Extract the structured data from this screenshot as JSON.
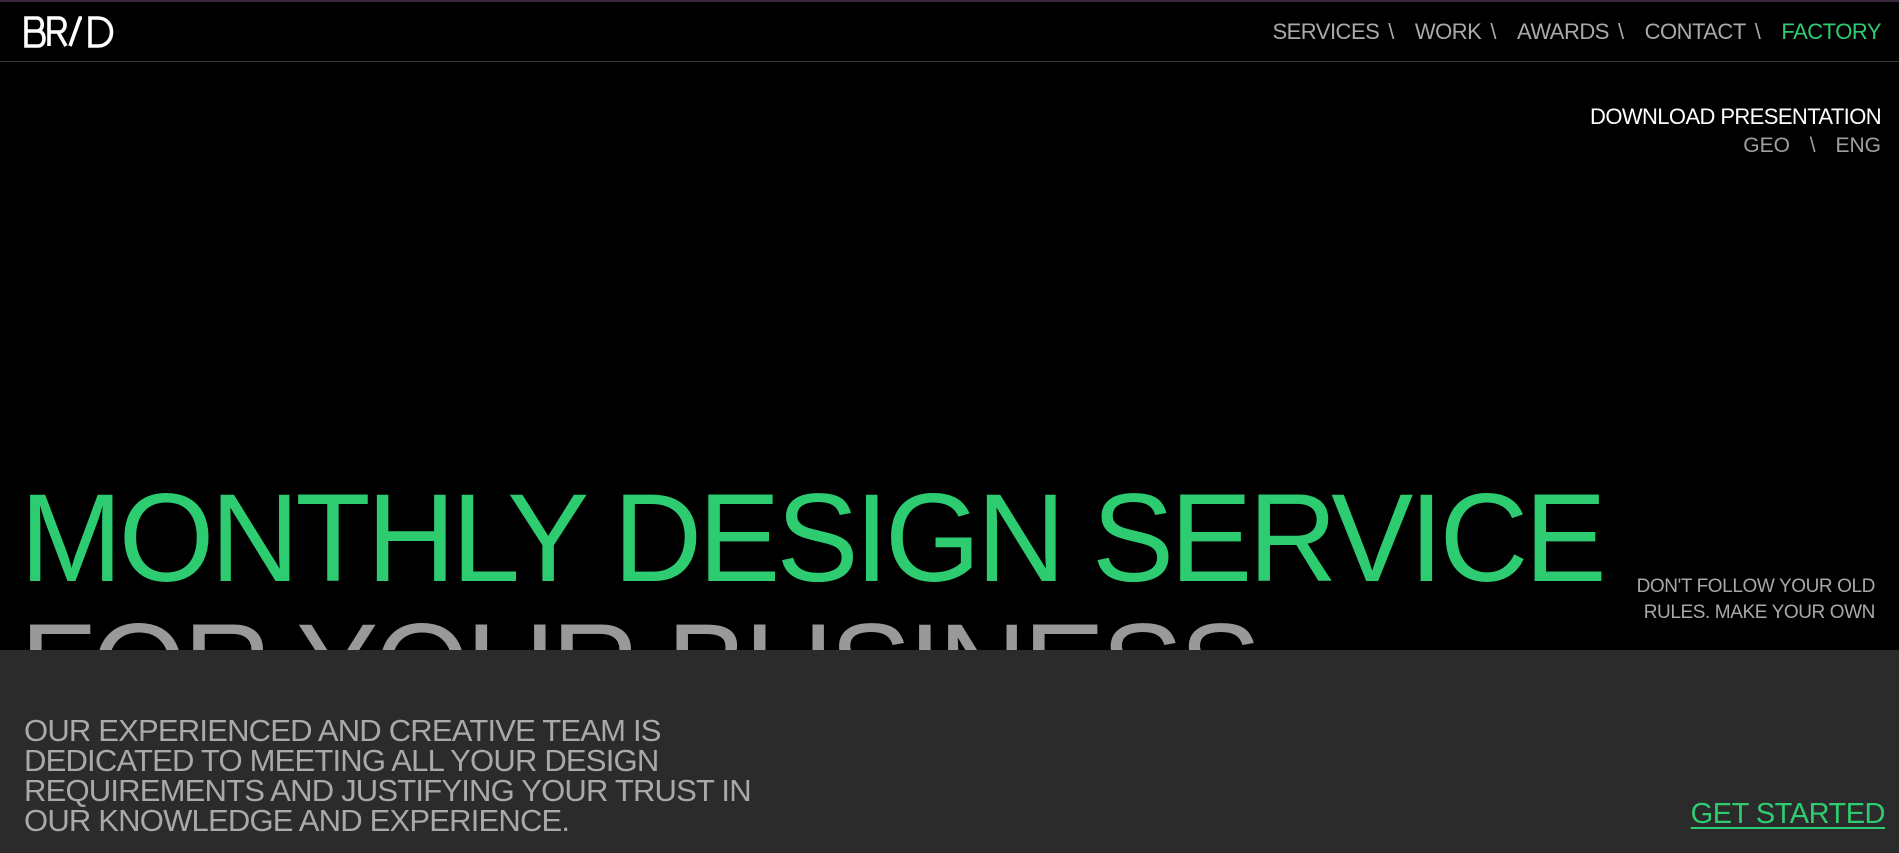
{
  "header": {
    "logo_text": "BRAD",
    "nav": [
      {
        "label": "SERVICES",
        "active": false
      },
      {
        "label": "WORK",
        "active": false
      },
      {
        "label": "AWARDS",
        "active": false
      },
      {
        "label": "CONTACT",
        "active": false
      },
      {
        "label": "FACTORY",
        "active": true
      }
    ],
    "nav_separator": "\\"
  },
  "utility": {
    "download_label": "DOWNLOAD PRESENTATION",
    "languages": [
      "GEO",
      "ENG"
    ],
    "language_separator": "\\"
  },
  "hero": {
    "title_line1": "MONTHLY DESIGN SERVICE",
    "title_line2": "FOR YOUR BUSINESS",
    "tagline_line1": "DON'T FOLLOW YOUR OLD",
    "tagline_line2": "RULES. MAKE YOUR OWN"
  },
  "intro": {
    "text": "OUR EXPERIENCED AND CREATIVE TEAM IS DEDICATED TO MEETING ALL YOUR DESIGN REQUIREMENTS AND JUSTIFYING YOUR TRUST IN OUR KNOWLEDGE AND EXPERIENCE.",
    "cta_label": "GET STARTED"
  },
  "colors": {
    "accent": "#2ecc71",
    "background": "#000000",
    "lower_background": "#2b2b2b",
    "muted_text": "#a9a9a9"
  }
}
